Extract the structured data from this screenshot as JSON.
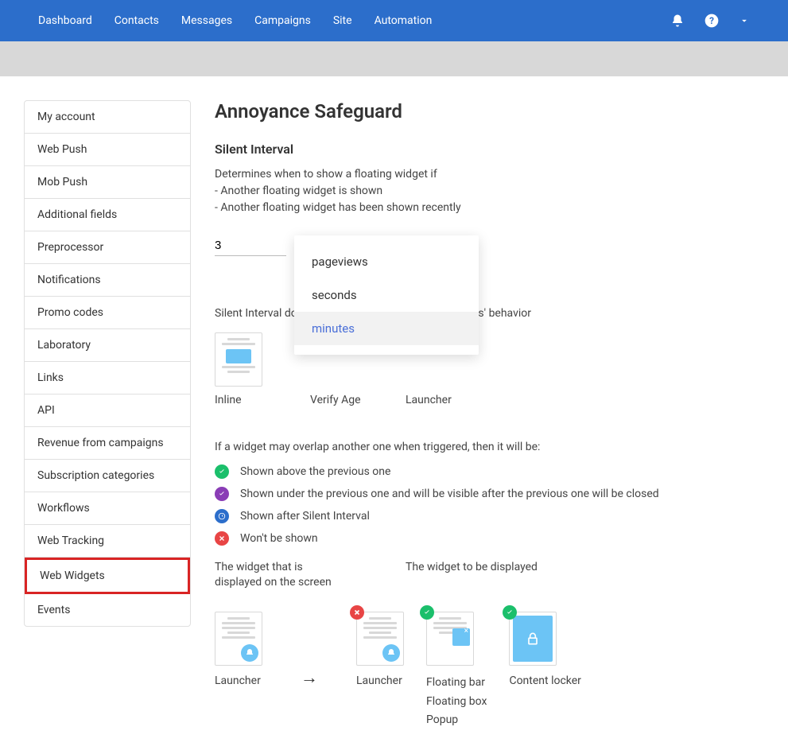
{
  "topnav": {
    "items": [
      "Dashboard",
      "Contacts",
      "Messages",
      "Campaigns",
      "Site",
      "Automation"
    ]
  },
  "sidebar": {
    "items": [
      "My account",
      "Web Push",
      "Mob Push",
      "Additional fields",
      "Preprocessor",
      "Notifications",
      "Promo codes",
      "Laboratory",
      "Links",
      "API",
      "Revenue from campaigns",
      "Subscription categories",
      "Workflows",
      "Web Tracking",
      "Web Widgets",
      "Events"
    ],
    "active_index": 14
  },
  "page": {
    "title": "Annoyance Safeguard",
    "section": "Silent Interval",
    "desc_lines": [
      "Determines when to show a floating widget if",
      "- Another floating widget is shown",
      "- Another floating widget has been shown recently"
    ],
    "interval_value": "3",
    "interval_unit": "minutes",
    "unit_options": [
      "pageviews",
      "seconds",
      "minutes"
    ],
    "unit_selected_index": 2,
    "affect_text": "Silent Interval doesn't affect the following widget types' behavior",
    "noaffect_widgets": [
      "Inline",
      "Verify Age",
      "Launcher"
    ],
    "overlap_intro": "If a widget may overlap another one when triggered, then it will be:",
    "overlap_rules": [
      {
        "color": "green",
        "text": "Shown above the previous one"
      },
      {
        "color": "purple",
        "text": "Shown under the previous one and will be visible after the previous one will be closed"
      },
      {
        "color": "blue",
        "text": "Shown after Silent Interval"
      },
      {
        "color": "red",
        "text": "Won't be shown"
      }
    ],
    "compare_header_left": "The widget that is displayed on the screen",
    "compare_header_right": "The widget to be displayed",
    "compare": {
      "left_label": "Launcher",
      "right": [
        {
          "label": "Launcher",
          "badge": "red"
        },
        {
          "label_lines": [
            "Floating bar",
            "Floating box",
            "Popup"
          ],
          "badge": "green"
        },
        {
          "label": "Content locker",
          "badge": "green"
        }
      ]
    }
  }
}
